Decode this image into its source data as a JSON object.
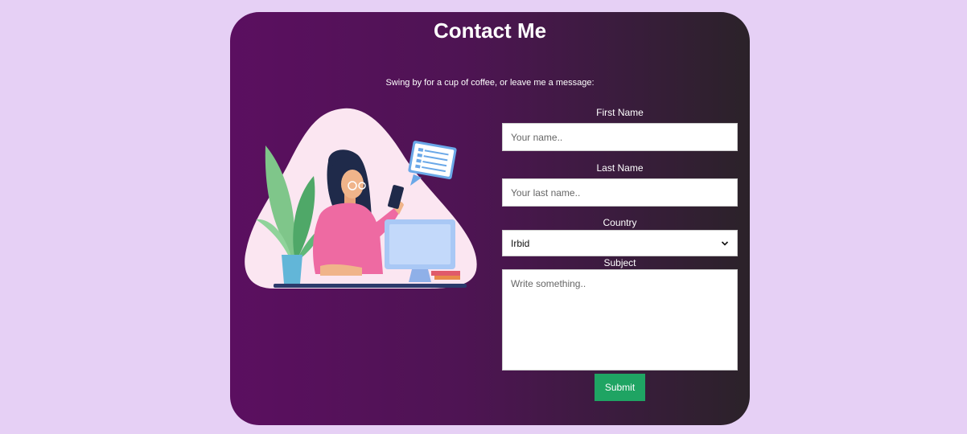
{
  "header": {
    "title": "Contact Me",
    "subtitle": "Swing by for a cup of coffee, or leave me a message:"
  },
  "form": {
    "first_name": {
      "label": "First Name",
      "placeholder": "Your name.."
    },
    "last_name": {
      "label": "Last Name",
      "placeholder": "Your last name.."
    },
    "country": {
      "label": "Country",
      "selected": "Irbid"
    },
    "subject": {
      "label": "Subject",
      "placeholder": "Write something.."
    },
    "submit_label": "Submit"
  },
  "colors": {
    "page_background": "#e6d0f5",
    "card_gradient_start": "#5b0f60",
    "card_gradient_end": "#2b2229",
    "submit_button": "#1fa463"
  },
  "icons": {
    "country_dropdown": "chevron-down-icon",
    "illustration": "woman-at-computer-illustration"
  }
}
